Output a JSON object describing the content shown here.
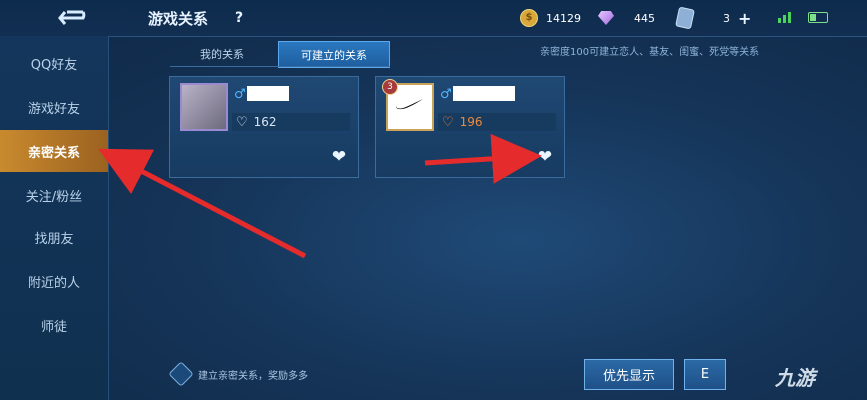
{
  "header": {
    "title": "游戏关系",
    "help_label": "?",
    "coins": "14129",
    "gems": "445",
    "tickets": "3",
    "back_label": "←"
  },
  "sidebar": {
    "items": [
      {
        "label": "QQ好友"
      },
      {
        "label": "游戏好友"
      },
      {
        "label": "亲密关系"
      },
      {
        "label": "关注/粉丝"
      },
      {
        "label": "找朋友"
      },
      {
        "label": "附近的人"
      },
      {
        "label": "师徒"
      }
    ],
    "active_index": 2
  },
  "tabs": [
    {
      "label": "我的关系"
    },
    {
      "label": "可建立的关系"
    }
  ],
  "hint_top": "亲密度100可建立恋人、基友、闺蜜、死党等关系",
  "cards": [
    {
      "intimacy": "162",
      "heart_color": "white",
      "badge": ""
    },
    {
      "intimacy": "196",
      "heart_color": "orange",
      "badge": "3"
    }
  ],
  "bottom": {
    "hint": "建立亲密关系，奖励多多",
    "priority_label": "优先显示",
    "second_label": "E"
  },
  "watermark": "九游",
  "colors": {
    "accent_active": "#c98a2e",
    "annotation_arrow": "#e52b2b"
  }
}
